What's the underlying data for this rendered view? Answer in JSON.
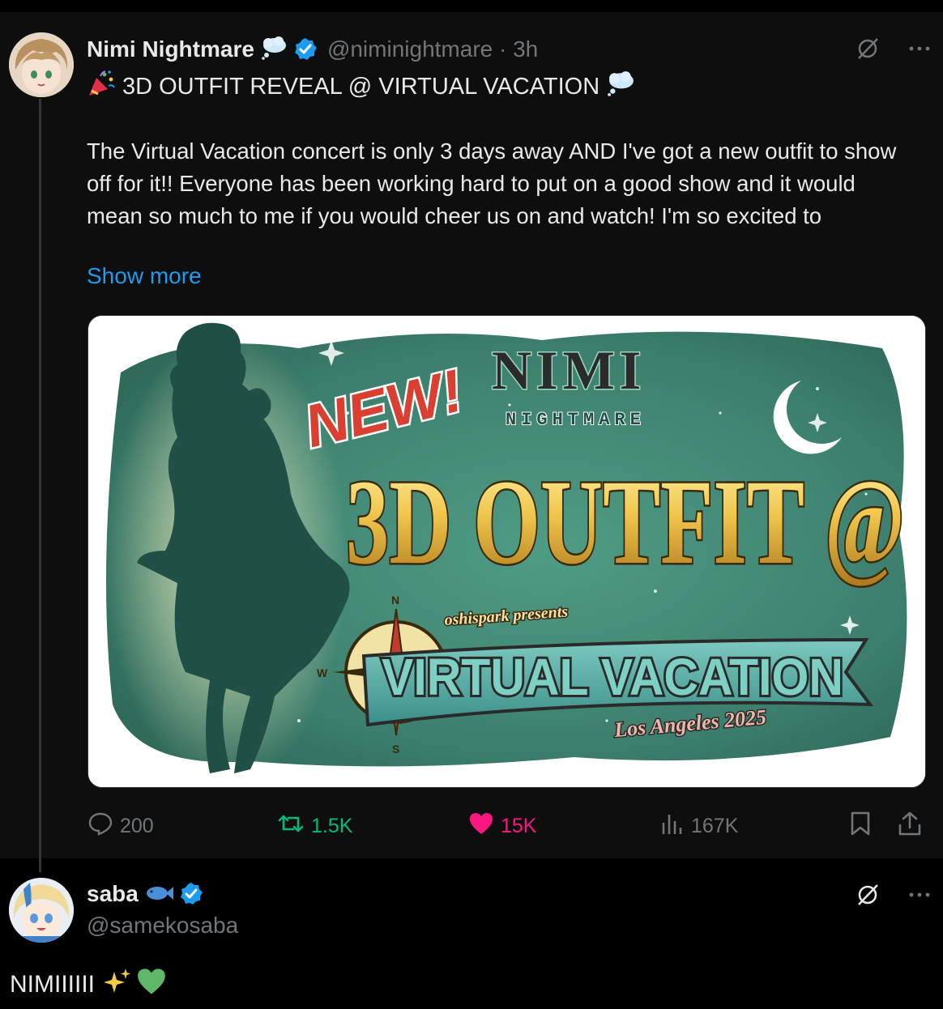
{
  "post": {
    "author": {
      "name": "Nimi Nightmare",
      "handle": "@niminightmare · 3h",
      "name_emoji": "thought-balloon-icon",
      "verified": true
    },
    "title_emoji": "party-popper-icon",
    "title": "3D OUTFIT REVEAL @ VIRTUAL VACATION",
    "title_trailing_emoji": "thought-balloon-icon",
    "body": "The Virtual Vacation concert is only 3 days away AND I've got a new outfit to show off for it!! Everyone has been working hard to put on a good show and it would mean so much to me if you would cheer us on and watch! I'm so excited to",
    "show_more": "Show more",
    "image": {
      "new_badge": "NEW!",
      "logo_top": "NIMI",
      "logo_bottom": "NIGHTMARE",
      "headline": "3D OUTFIT @",
      "presenter": "oshispark presents",
      "event": "VIRTUAL VACATION",
      "location": "Los Angeles 2025",
      "compass_n": "N",
      "compass_s": "S",
      "compass_w": "W"
    },
    "stats": {
      "replies": "200",
      "reposts": "1.5K",
      "likes": "15K",
      "views": "167K"
    },
    "colors": {
      "repost": "#00ba7c",
      "like": "#f91880",
      "link": "#1d9bf0",
      "muted": "#71767b"
    }
  },
  "reply": {
    "author": {
      "name": "saba",
      "handle": "@samekosaba",
      "name_emoji": "fish-icon",
      "verified": true
    },
    "text": "NIMIIIIII",
    "emojis": [
      "sparkles-icon",
      "green-heart-icon"
    ]
  }
}
